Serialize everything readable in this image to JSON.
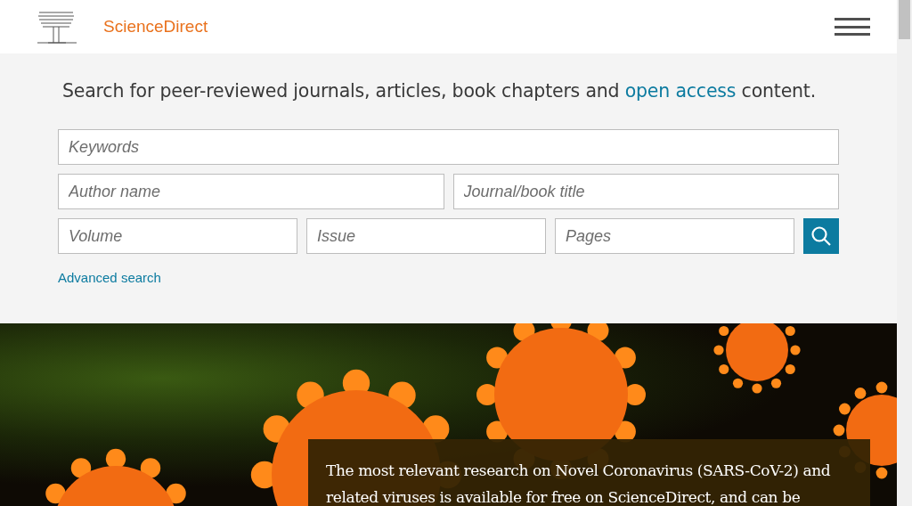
{
  "header": {
    "brand": "ScienceDirect"
  },
  "search": {
    "headline_before": "Search for peer-reviewed journals, articles, book chapters and ",
    "headline_link": "open access",
    "headline_after": " content.",
    "rows": [
      [
        {
          "placeholder": "Keywords"
        }
      ],
      [
        {
          "placeholder": "Author name"
        },
        {
          "placeholder": "Journal/book title"
        }
      ],
      [
        {
          "placeholder": "Volume"
        },
        {
          "placeholder": "Issue"
        },
        {
          "placeholder": "Pages"
        }
      ]
    ],
    "advanced_link": "Advanced search"
  },
  "hero": {
    "notice": "The most relevant research on Novel Coronavirus (SARS-CoV-2) and related viruses is available for free on ScienceDirect, and can be"
  }
}
